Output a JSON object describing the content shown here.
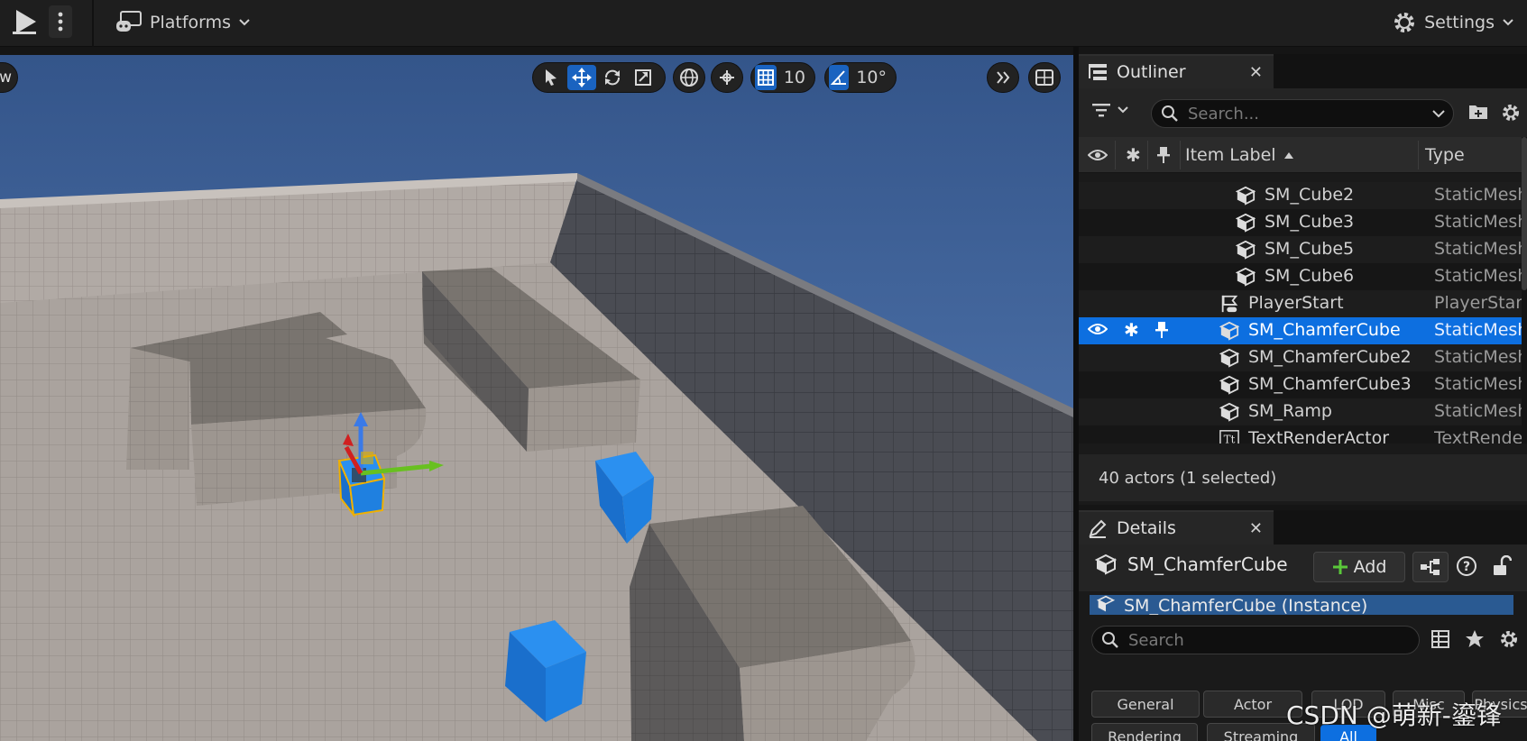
{
  "toolbar": {
    "platforms_label": "Platforms",
    "settings_label": "Settings"
  },
  "viewport": {
    "left_button_text": "w",
    "grid_snap_value": "10",
    "rotation_snap_value": "10°"
  },
  "outliner": {
    "tab_label": "Outliner",
    "search_placeholder": "Search...",
    "columns": {
      "item_label": "Item Label",
      "type": "Type"
    },
    "rows": [
      {
        "label": "SM_Cube2",
        "type": "StaticMesh",
        "icon": "cube-icon",
        "indent": 2
      },
      {
        "label": "SM_Cube3",
        "type": "StaticMesh",
        "icon": "cube-icon",
        "indent": 2
      },
      {
        "label": "SM_Cube5",
        "type": "StaticMesh",
        "icon": "cube-icon",
        "indent": 2
      },
      {
        "label": "SM_Cube6",
        "type": "StaticMesh",
        "icon": "cube-icon",
        "indent": 2
      },
      {
        "label": "PlayerStart",
        "type": "PlayerStart",
        "icon": "player-start-icon",
        "indent": 1
      },
      {
        "label": "SM_ChamferCube",
        "type": "StaticMesh",
        "icon": "cube-icon",
        "indent": 1,
        "selected": true
      },
      {
        "label": "SM_ChamferCube2",
        "type": "StaticMesh",
        "icon": "cube-icon",
        "indent": 1
      },
      {
        "label": "SM_ChamferCube3",
        "type": "StaticMesh",
        "icon": "cube-icon",
        "indent": 1
      },
      {
        "label": "SM_Ramp",
        "type": "StaticMesh",
        "icon": "cube-icon",
        "indent": 1
      },
      {
        "label": "TextRenderActor",
        "type": "TextRender",
        "icon": "text-render-icon",
        "indent": 1
      }
    ],
    "status": "40 actors (1 selected)"
  },
  "details": {
    "tab_label": "Details",
    "actor_name": "SM_ChamferCube",
    "add_label": "Add",
    "instance_label": "SM_ChamferCube (Instance)",
    "search_placeholder": "Search",
    "categories": [
      "General",
      "Actor",
      "LOD",
      "Misc",
      "Physics",
      "Rendering",
      "Streaming",
      "All"
    ]
  },
  "watermark": "CSDN @萌新-鎏锋",
  "colors": {
    "accent": "#0d6fe0",
    "sky": "#3d6198",
    "floor": "#aaa39e",
    "cube": "#1f7fe0"
  }
}
